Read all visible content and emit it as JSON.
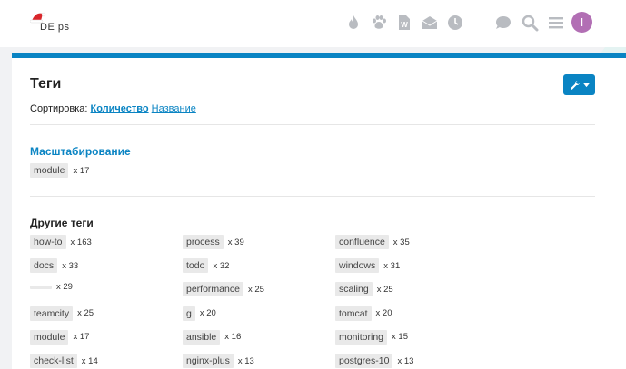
{
  "header": {
    "logo_text": "DE   ps",
    "avatar_letter": "I"
  },
  "nav_icons": [
    "fire-icon",
    "paw-icon",
    "document-w-icon",
    "envelope-icon",
    "clock-icon",
    "chat-icon",
    "search-icon",
    "menu-icon"
  ],
  "colors": {
    "accent": "#0a84c3",
    "avatar": "#b26fb4",
    "nav_icon": "#b9bcc1",
    "tag_bg": "#e9e9e9"
  },
  "page": {
    "title": "Теги",
    "sort_label": "Сортировка:",
    "sort_by_count": "Количество",
    "sort_by_name": "Название"
  },
  "category": {
    "title": "Масштабирование",
    "tags": [
      {
        "name": "module",
        "count": "x 17"
      }
    ]
  },
  "other": {
    "title": "Другие теги",
    "tags": [
      {
        "name": "how-to",
        "count": "x 163"
      },
      {
        "name": "process",
        "count": "x 39"
      },
      {
        "name": "confluence",
        "count": "x 35"
      },
      {
        "name": "docs",
        "count": "x 33"
      },
      {
        "name": "todo",
        "count": "x 32"
      },
      {
        "name": "windows",
        "count": "x 31"
      },
      {
        "name": " ",
        "count": "x 29"
      },
      {
        "name": "performance",
        "count": "x 25"
      },
      {
        "name": "scaling",
        "count": "x 25"
      },
      {
        "name": "teamcity",
        "count": "x 25"
      },
      {
        "name": "g",
        "count": "x 20"
      },
      {
        "name": "tomcat",
        "count": "x 20"
      },
      {
        "name": "module",
        "count": "x 17"
      },
      {
        "name": "ansible",
        "count": "x 16"
      },
      {
        "name": "monitoring",
        "count": "x 15"
      },
      {
        "name": "check-list",
        "count": "x 14"
      },
      {
        "name": "nginx-plus",
        "count": "x 13"
      },
      {
        "name": "postgres-10",
        "count": "x 13"
      }
    ]
  }
}
